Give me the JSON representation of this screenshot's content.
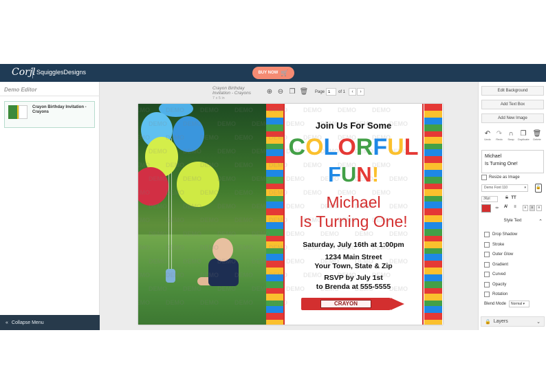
{
  "topbar": {
    "logo": "Corjl",
    "shop_name": "SquigglesDesigns",
    "buy_now": "BUY NOW"
  },
  "left_panel": {
    "title": "Demo Editor",
    "template_name": "Crayon Birthday Invitation - Crayons",
    "collapse_label": "Collapse Menu"
  },
  "doc": {
    "title": "Crayon Birthday Invitation - Crayons",
    "size": "7 x 5 in",
    "page_label": "Page",
    "page_value": "1",
    "page_of": "of 1"
  },
  "invite": {
    "join": "Join Us For Some",
    "colorful": [
      "C",
      "O",
      "L",
      "O",
      "R",
      "F",
      "U",
      "L"
    ],
    "colorful_colors": [
      "#43a047",
      "#fbc02d",
      "#1e88e5",
      "#e53935",
      "#43a047",
      "#1e88e5",
      "#fbc02d",
      "#e53935"
    ],
    "fun": [
      "F",
      "U",
      "N",
      "!"
    ],
    "fun_colors": [
      "#1e88e5",
      "#43a047",
      "#e53935",
      "#fbc02d"
    ],
    "name_line1": "Michael",
    "name_line2": "Is Turning One!",
    "date": "Saturday, July 16th at 1:00pm",
    "address1": "1234 Main Street",
    "address2": "Your Town, State & Zip",
    "rsvp1": "RSVP by July 1st",
    "rsvp2": "to Brenda at 555-5555",
    "crayon_label": "CRAYON",
    "watermark": "DEMO"
  },
  "right_panel": {
    "edit_background": "Edit Background",
    "add_text_box": "Add Text Box",
    "add_new_image": "Add New Image",
    "tools": [
      {
        "icon": "undo-icon",
        "label": "Undo"
      },
      {
        "icon": "redo-icon",
        "label": "Redo"
      },
      {
        "icon": "snap-icon",
        "label": "Snap"
      },
      {
        "icon": "duplicate-icon",
        "label": "Duplicate"
      },
      {
        "icon": "delete-icon",
        "label": "Delete"
      }
    ],
    "text_line1": "Michael",
    "text_line2": "Is Turning One!",
    "resize_as_image": "Resize as Image",
    "font": "Demo Font 110",
    "font_size": "36pt",
    "text_color": "#d32f2f",
    "style_text": "Style Text",
    "style_options": [
      "Drop Shadow",
      "Stroke",
      "Outer Glow",
      "Gradient",
      "Curved",
      "Opacity",
      "Rotation"
    ],
    "blend_mode_label": "Blend Mode",
    "blend_mode_value": "Normal",
    "layers": "Layers"
  }
}
